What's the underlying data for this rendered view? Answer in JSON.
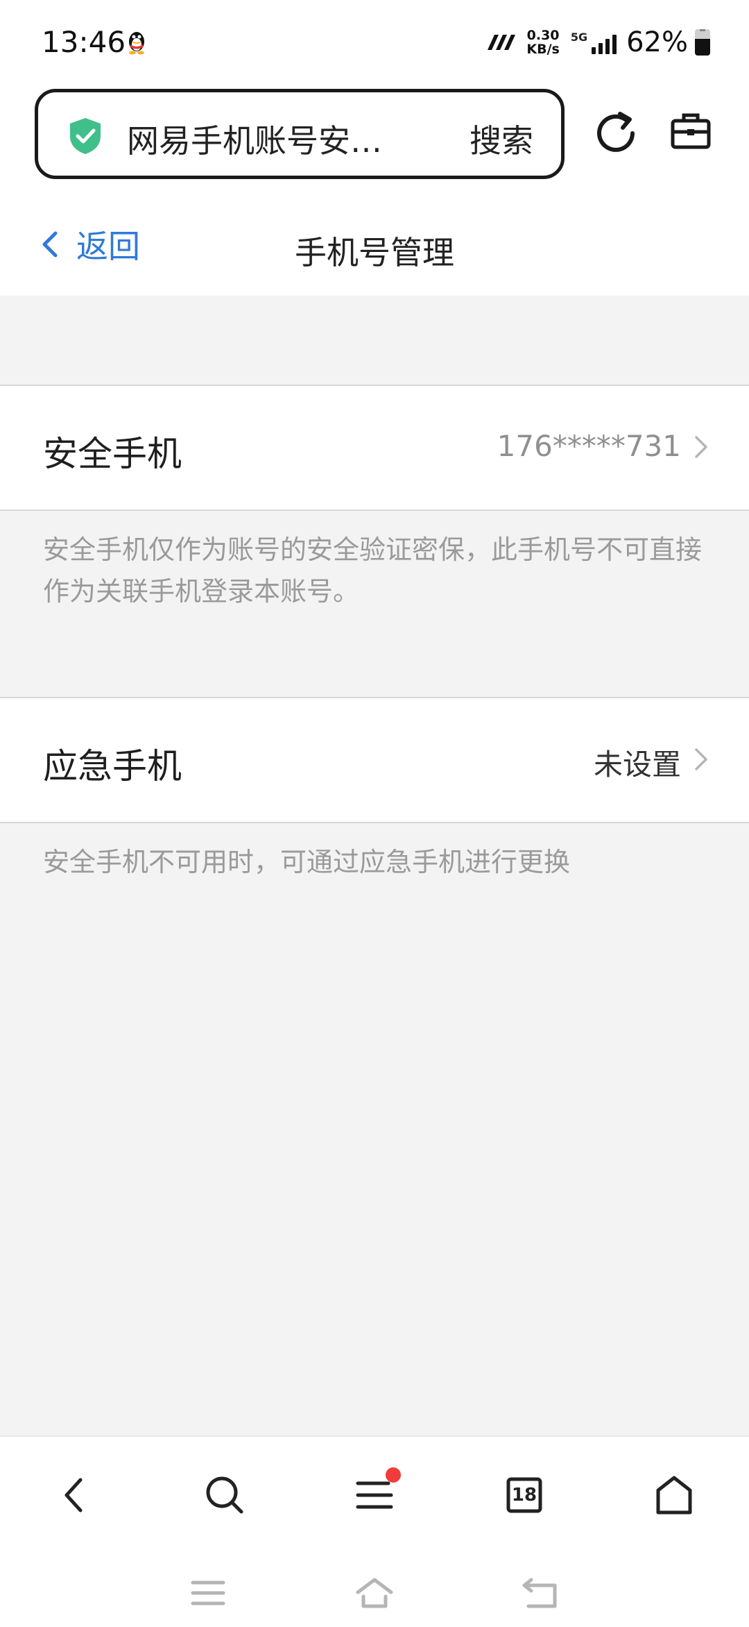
{
  "status_bar": {
    "time": "13:46",
    "net_speed_value": "0.30",
    "net_speed_unit": "KB/s",
    "network_type": "5G",
    "battery_percent": "62%",
    "battery_level": 0.62
  },
  "browser": {
    "url_title": "网易手机账号安…",
    "search_label": "搜索"
  },
  "header": {
    "back_label": "返回",
    "title": "手机号管理"
  },
  "security_phone": {
    "label": "安全手机",
    "value": "176*****731",
    "note": "安全手机仅作为账号的安全验证密保，此手机号不可直接作为关联手机登录本账号。"
  },
  "emergency_phone": {
    "label": "应急手机",
    "value": "未设置",
    "note": "安全手机不可用时，可通过应急手机进行更换"
  },
  "bottom_nav": {
    "tab_count": "18",
    "menu_has_notification": true
  },
  "colors": {
    "accent": "#2f7ad8",
    "shield": "#3fbf8a",
    "notification": "#f23b3b"
  }
}
